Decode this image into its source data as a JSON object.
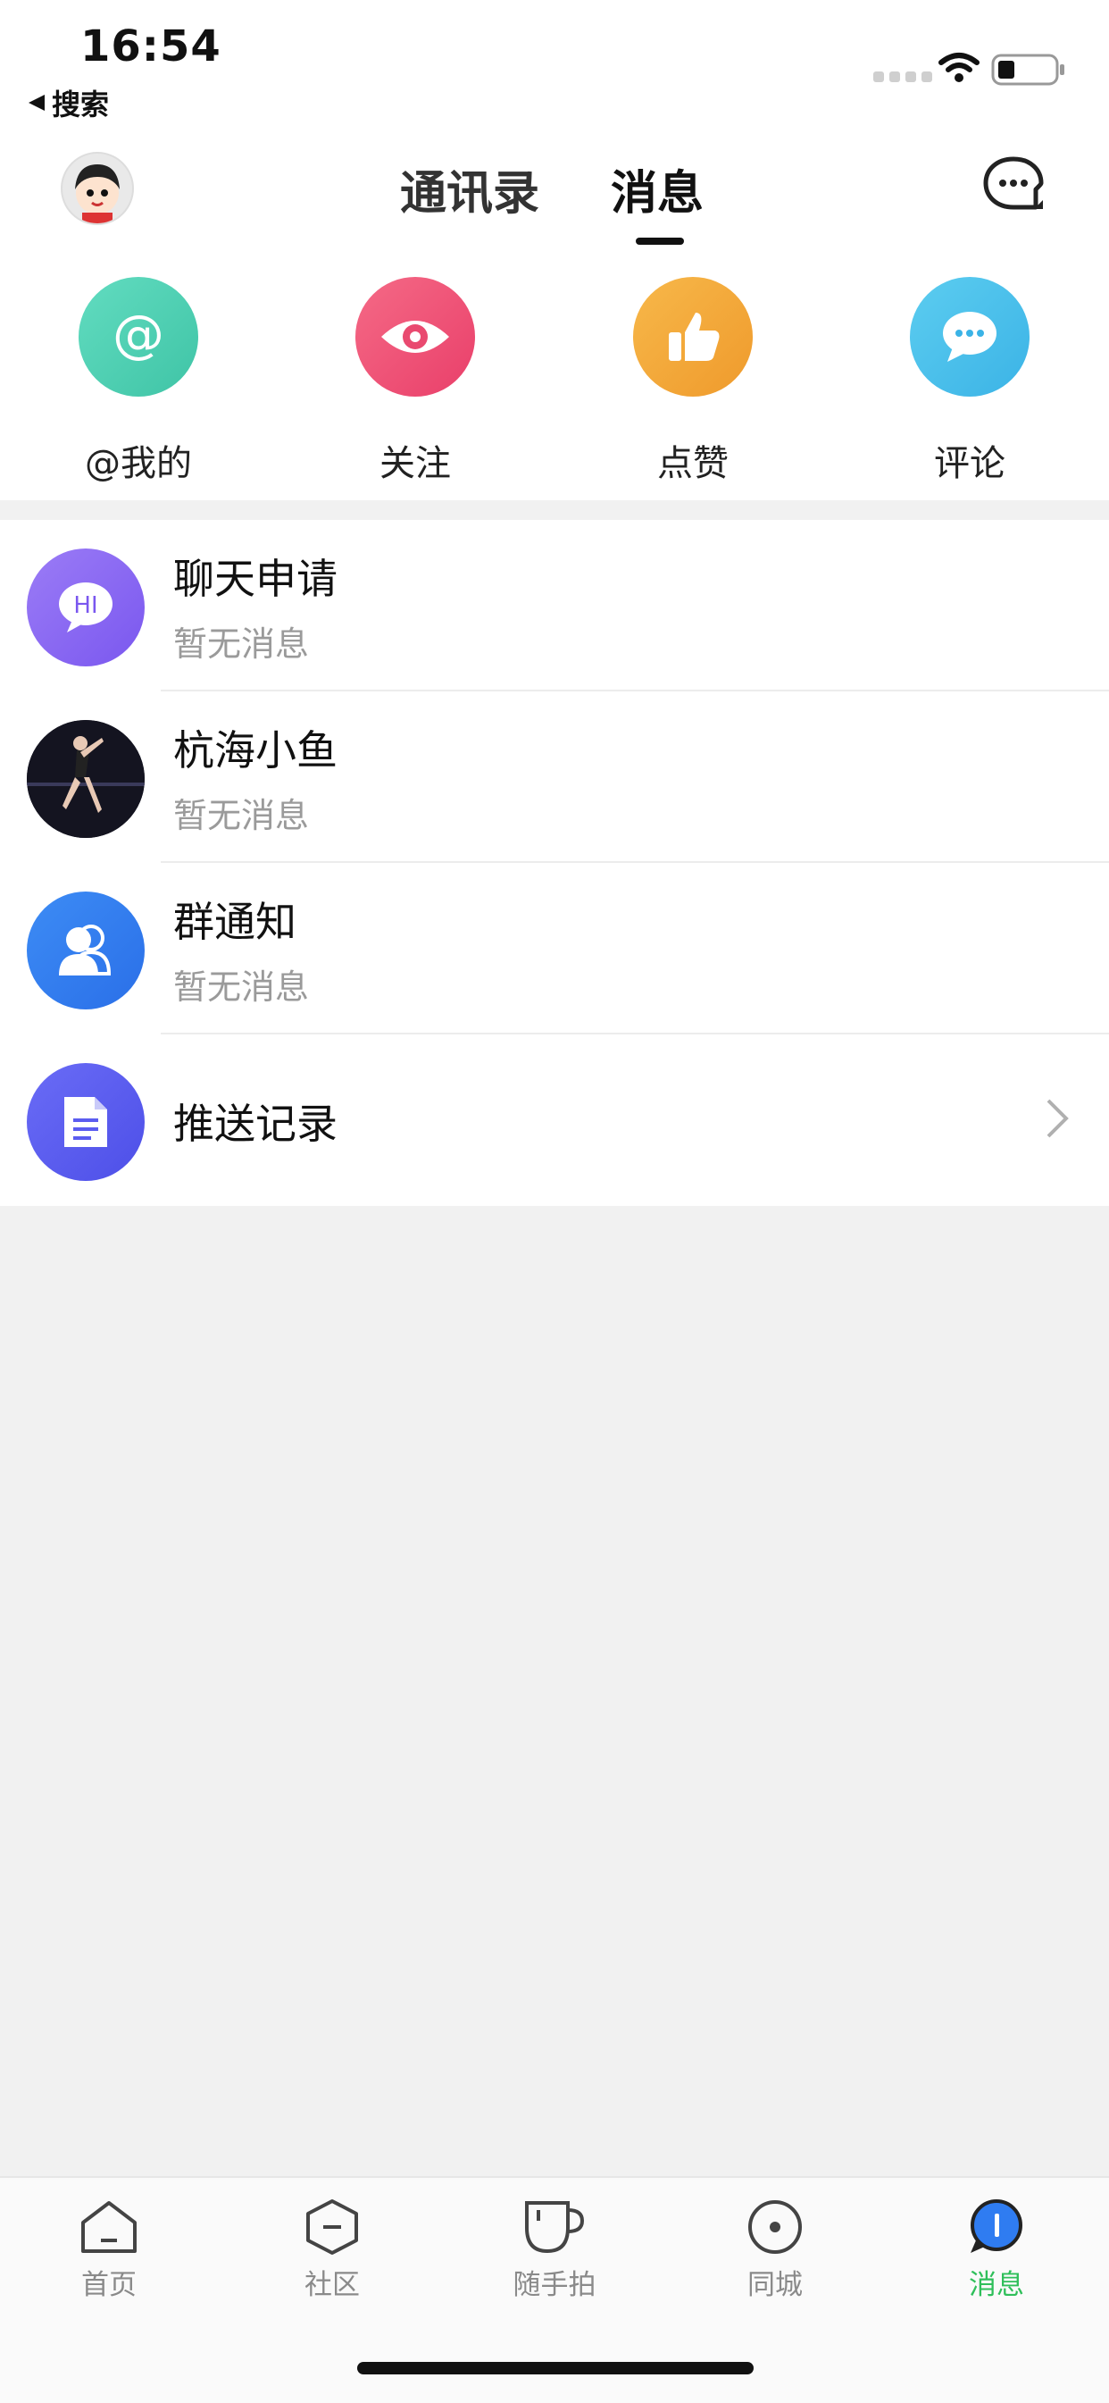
{
  "status_bar": {
    "time": "16:54",
    "back_label": "搜索"
  },
  "header": {
    "tabs": [
      {
        "label": "通讯录",
        "active": false
      },
      {
        "label": "消息",
        "active": true
      }
    ],
    "icons": {
      "profile": "user-avatar",
      "chat": "chat-bubble-icon"
    }
  },
  "quick_actions": [
    {
      "label": "@我的",
      "icon": "at-icon",
      "color": "#5fd6b5"
    },
    {
      "label": "关注",
      "icon": "eye-icon",
      "color": "#f0557a"
    },
    {
      "label": "点赞",
      "icon": "thumbs-up-icon",
      "color": "#f2a93b"
    },
    {
      "label": "评论",
      "icon": "comment-icon",
      "color": "#4ec3ea"
    }
  ],
  "messages": [
    {
      "title": "聊天申请",
      "subtitle": "暂无消息",
      "icon": "hi-bubble-icon",
      "color": "#8a6cf2"
    },
    {
      "title": "杭海小鱼",
      "subtitle": "暂无消息",
      "icon": "user-photo",
      "color": "#1a1a2a"
    },
    {
      "title": "群通知",
      "subtitle": "暂无消息",
      "icon": "group-icon",
      "color": "#2f7cf1"
    },
    {
      "title": "推送记录",
      "subtitle": "",
      "icon": "document-icon",
      "color": "#5b5df0"
    }
  ],
  "tab_bar": [
    {
      "label": "首页",
      "icon": "home-icon",
      "active": false
    },
    {
      "label": "社区",
      "icon": "community-icon",
      "active": false
    },
    {
      "label": "随手拍",
      "icon": "cup-icon",
      "active": false
    },
    {
      "label": "同城",
      "icon": "location-circle-icon",
      "active": false
    },
    {
      "label": "消息",
      "icon": "message-icon",
      "active": true
    }
  ],
  "colors": {
    "accent": "#2fbf5a",
    "text_muted": "#9a9a9a",
    "background": "#f1f1f1"
  }
}
